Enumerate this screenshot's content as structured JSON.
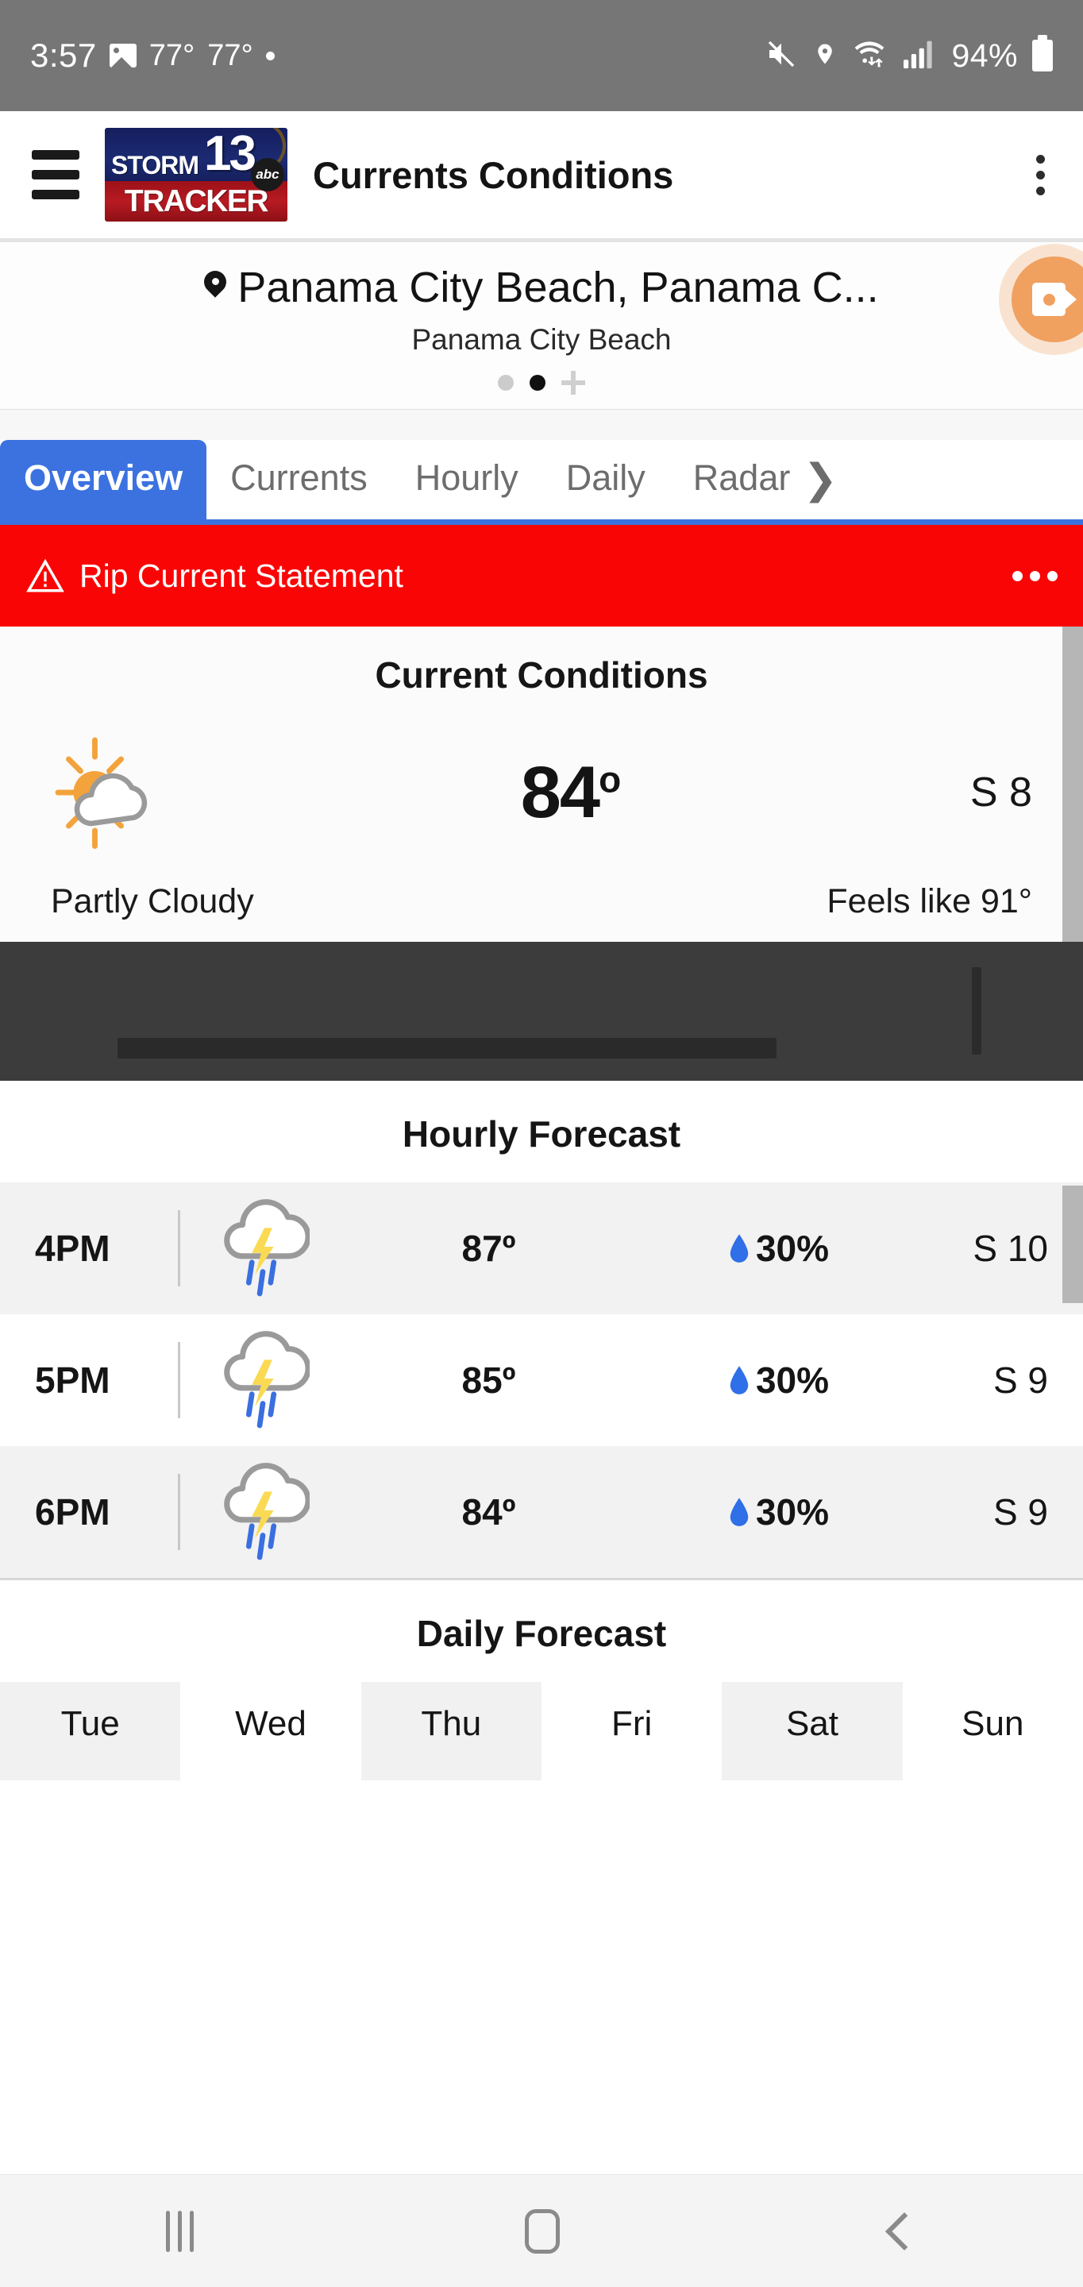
{
  "status_bar": {
    "time": "3:57",
    "temp_1": "77°",
    "temp_2": "77°",
    "battery_percent": "94%",
    "icons": [
      "image-icon",
      "dot-icon",
      "mute-icon",
      "location-icon",
      "wifi-icon",
      "cellular-signal-icon",
      "battery-icon"
    ]
  },
  "app_bar": {
    "menu_icon": "hamburger-menu-icon",
    "logo": {
      "storm": "STORM",
      "tracker": "TRACKER",
      "channel": "13",
      "network": "abc"
    },
    "title": "Currents Conditions",
    "overflow_icon": "kebab-menu-icon"
  },
  "location": {
    "pin_icon": "location-pin-icon",
    "title": "Panama City Beach, Panama C...",
    "subtitle": "Panama City Beach",
    "page_dots": [
      {
        "active": false
      },
      {
        "active": true
      }
    ],
    "add_label": "+",
    "fab_icon": "video-record-icon"
  },
  "tabs": [
    {
      "label": "Overview",
      "active": true
    },
    {
      "label": "Currents",
      "active": false
    },
    {
      "label": "Hourly",
      "active": false
    },
    {
      "label": "Daily",
      "active": false
    },
    {
      "label": "Radar",
      "active": false
    }
  ],
  "tabs_more_icon": "chevron-right-icon",
  "alert": {
    "icon": "warning-triangle-icon",
    "text": "Rip Current Statement",
    "overflow_icon": "ellipsis-icon",
    "color": "#fa0505"
  },
  "current_conditions": {
    "heading": "Current Conditions",
    "icon": "partly-cloudy-icon",
    "temperature": "84",
    "degree": "o",
    "wind": "S 8",
    "condition": "Partly Cloudy",
    "feels_like": "Feels like 91°"
  },
  "hourly": {
    "heading": "Hourly Forecast",
    "rows": [
      {
        "time": "4PM",
        "icon": "thunderstorm-icon",
        "temp": "87º",
        "pop": "30%",
        "wind": "S 10"
      },
      {
        "time": "5PM",
        "icon": "thunderstorm-icon",
        "temp": "85º",
        "pop": "30%",
        "wind": "S 9"
      },
      {
        "time": "6PM",
        "icon": "thunderstorm-icon",
        "temp": "84º",
        "pop": "30%",
        "wind": "S 9"
      }
    ]
  },
  "daily": {
    "heading": "Daily Forecast",
    "days": [
      "Tue",
      "Wed",
      "Thu",
      "Fri",
      "Sat",
      "Sun"
    ]
  },
  "nav_bar": {
    "recents_icon": "recents-icon",
    "home_icon": "home-icon",
    "back_icon": "back-icon"
  },
  "colors": {
    "accent_blue": "#3b72e0",
    "alert_red": "#fa0505",
    "sun_orange": "#f3a33c",
    "rain_blue": "#3a6fe0",
    "fab_orange": "#f0a05f"
  }
}
